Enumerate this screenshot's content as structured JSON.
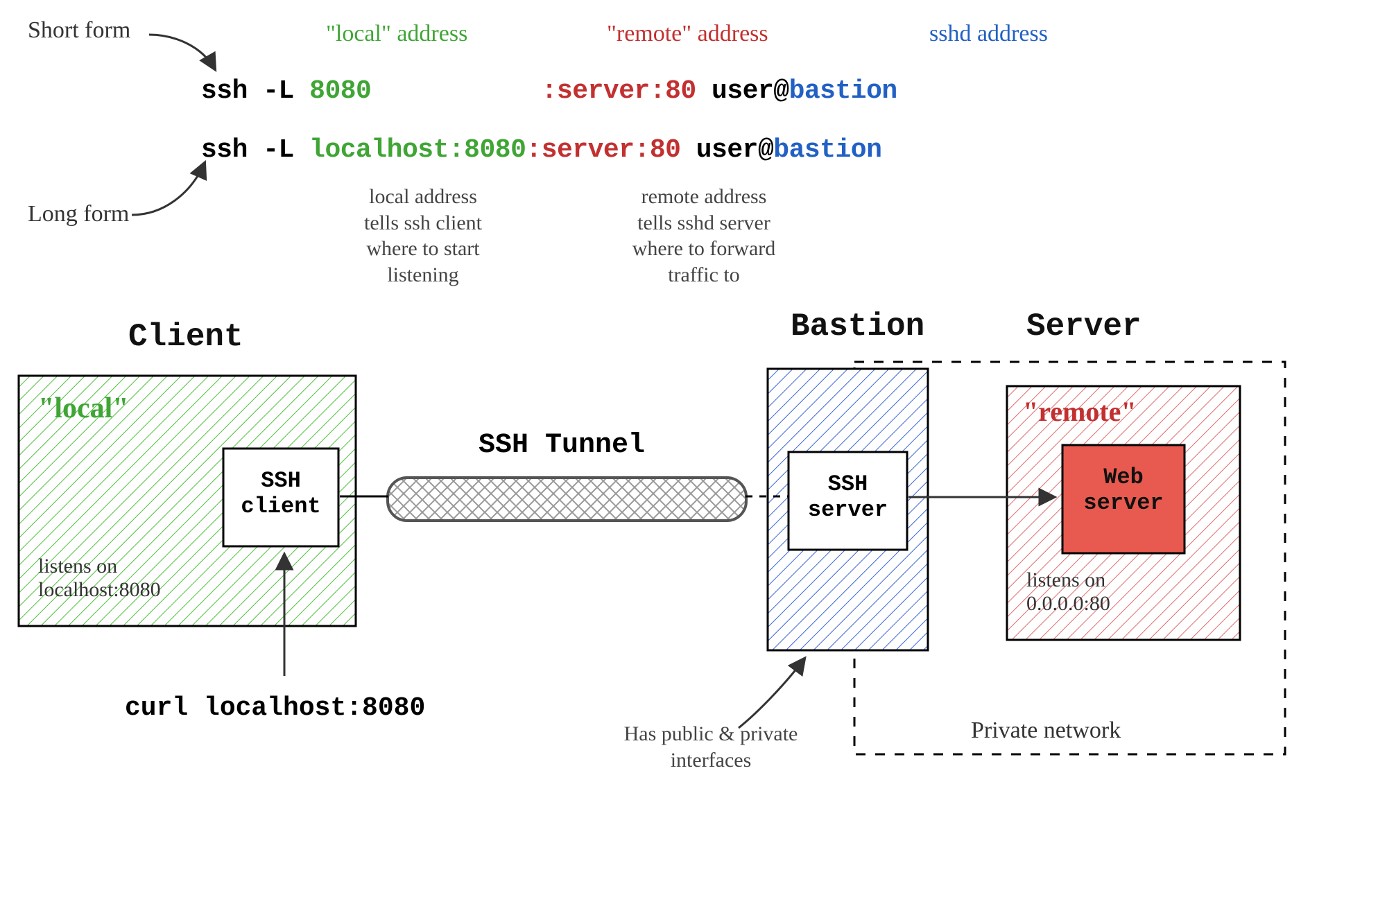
{
  "labels": {
    "short_form": "Short form",
    "long_form": "Long form",
    "local_address": "\"local\" address",
    "remote_address": "\"remote\" address",
    "sshd_address": "sshd address"
  },
  "cmd_short": {
    "prefix": "ssh -L ",
    "local": "8080",
    "pad": "           ",
    "remote": ":server:80",
    "user": " user@",
    "bastion": "bastion"
  },
  "cmd_long": {
    "prefix": "ssh -L ",
    "local": "localhost:8080",
    "remote": ":server:80",
    "user": " user@",
    "bastion": "bastion"
  },
  "notes": {
    "local_desc": "local address\ntells ssh client\nwhere to start\nlistening",
    "remote_desc": "remote address\ntells sshd server\nwhere to forward\ntraffic to",
    "bastion_desc": "Has public & private\ninterfaces",
    "private_net": "Private network",
    "curl": "curl localhost:8080"
  },
  "diagram": {
    "client_title": "Client",
    "bastion_title": "Bastion",
    "server_title": "Server",
    "local_tag": "\"local\"",
    "remote_tag": "\"remote\"",
    "ssh_client": "SSH\nclient",
    "ssh_server": "SSH\nserver",
    "web_server": "Web\nserver",
    "tunnel": "SSH Tunnel",
    "client_listen": "listens on\nlocalhost:8080",
    "server_listen": "listens on\n0.0.0.0:80"
  }
}
